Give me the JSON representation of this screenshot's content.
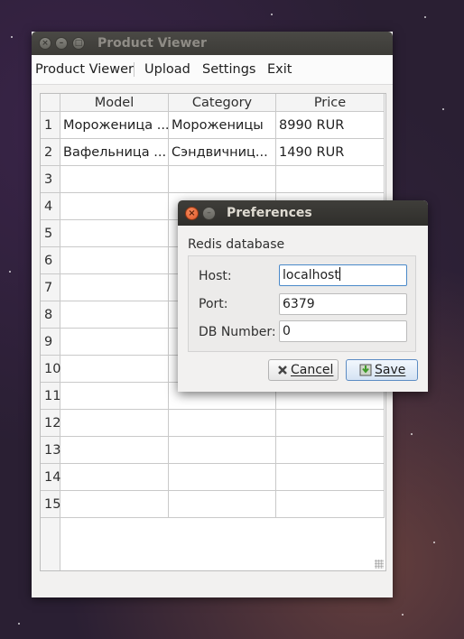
{
  "main_window": {
    "title": "Product Viewer",
    "menu": [
      "Product Viewer",
      "Upload",
      "Settings",
      "Exit"
    ]
  },
  "table": {
    "columns": [
      "Model",
      "Category",
      "Price"
    ],
    "row_numbers": [
      "1",
      "2",
      "3",
      "4",
      "5",
      "6",
      "7",
      "8",
      "9",
      "10",
      "11",
      "12",
      "13",
      "14",
      "15"
    ],
    "rows": [
      [
        "Мороженица ...",
        "Мороженицы",
        "8990 RUR"
      ],
      [
        "Вафельница ...",
        "Сэндвичниц...",
        "1490 RUR"
      ]
    ]
  },
  "dialog": {
    "title": "Preferences",
    "group_label": "Redis database",
    "fields": [
      {
        "label": "Host:",
        "value": "localhost"
      },
      {
        "label": "Port:",
        "value": "6379"
      },
      {
        "label": "DB Number:",
        "value": "0"
      }
    ],
    "cancel_label": "Cancel",
    "save_label": "Save"
  },
  "colors": {
    "close_button": "#e0582a",
    "focus_border": "#4a89c9",
    "titlebar": "#3c3b37"
  },
  "icons": {
    "cancel": "cross-icon",
    "save": "save-icon"
  }
}
